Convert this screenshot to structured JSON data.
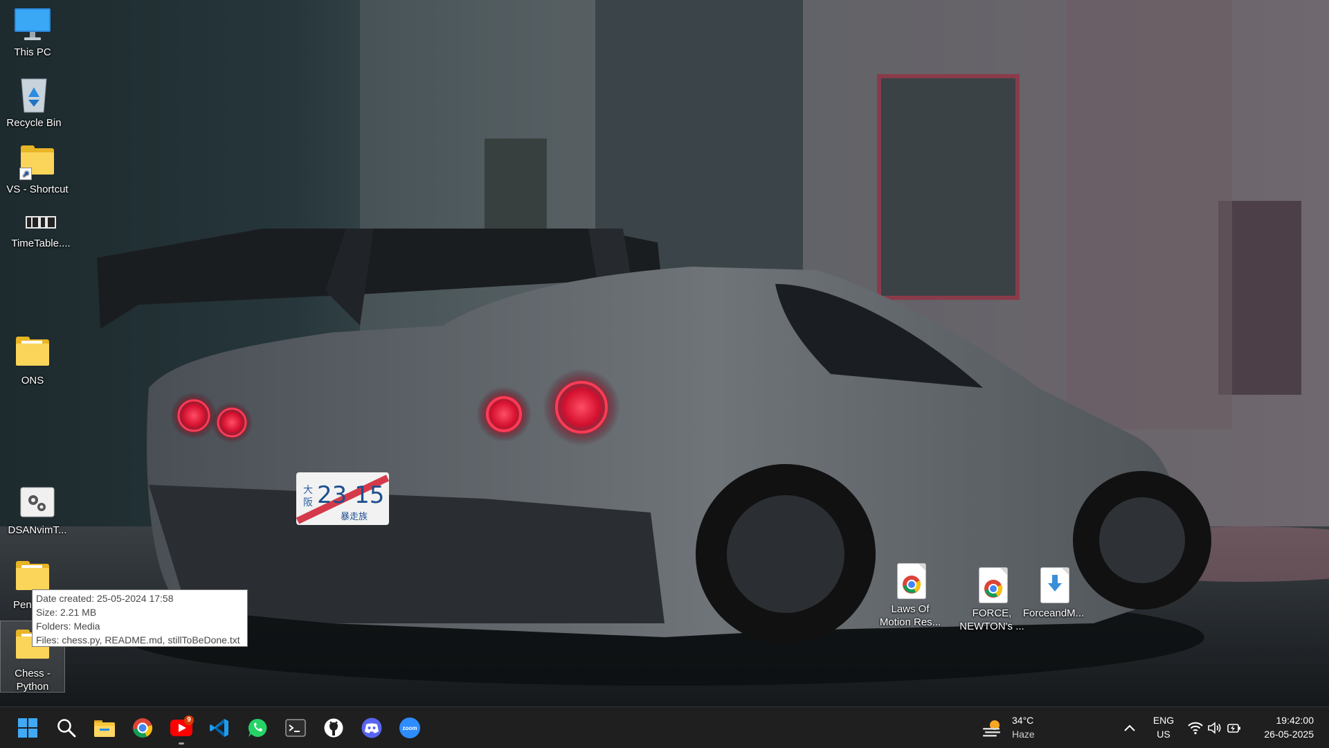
{
  "desktop": {
    "icons": {
      "this_pc": "This PC",
      "recycle_bin": "Recycle Bin",
      "vs_shortcut": "VS - Shortcut",
      "timetable": "TimeTable....",
      "ons": "ONS",
      "dsanvim": "DSANvimT...",
      "pen": "Pen",
      "chess_line1": "Chess -",
      "chess_line2": "Python",
      "laws_line1": "Laws Of",
      "laws_line2": "Motion Res...",
      "force_line1": "FORCE,",
      "force_line2": "NEWTON's ...",
      "forceandm": "ForceandM..."
    },
    "tooltip": {
      "date_created": "Date created: 25-05-2024 17:58",
      "size": "Size: 2.21 MB",
      "folders": "Folders: Media",
      "files": "Files: chess.py, README.md, stillToBeDone.txt"
    },
    "wallpaper_plate": {
      "number": "23 15",
      "region_1": "大",
      "region_2": "阪",
      "kana": "暴走族"
    }
  },
  "taskbar": {
    "apps": [
      "start-icon",
      "search-icon",
      "file-explorer-icon",
      "chrome-icon",
      "youtube-icon",
      "vscode-icon",
      "whatsapp-icon",
      "terminal-icon",
      "github-icon",
      "discord-icon",
      "zoom-icon"
    ],
    "youtube_badge": "9",
    "zoom_label": "zoom",
    "weather": {
      "temp": "34°C",
      "condition": "Haze"
    },
    "language": {
      "line1": "ENG",
      "line2": "US"
    },
    "clock": {
      "time": "19:42:00",
      "date": "26-05-2025"
    }
  },
  "colors": {
    "taskbar_bg": "#1f1f1f",
    "tail_light": "#ff2a45",
    "folder": "#f8c737",
    "accent": "#0078d4"
  }
}
